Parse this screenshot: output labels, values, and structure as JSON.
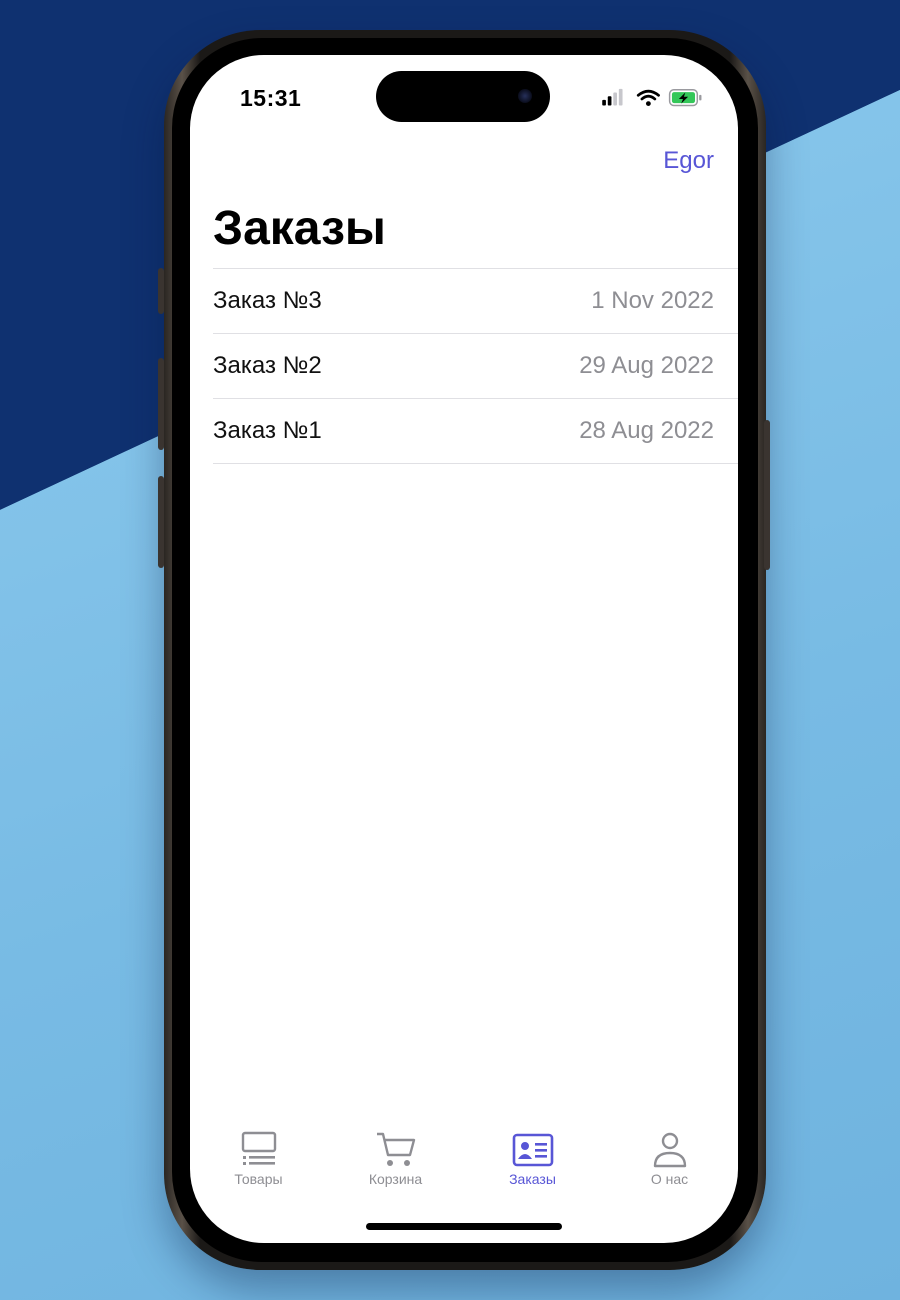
{
  "status_bar": {
    "time": "15:31"
  },
  "nav": {
    "user_button": "Egor"
  },
  "page": {
    "title": "Заказы"
  },
  "orders": [
    {
      "title": "Заказ №3",
      "date": "1 Nov 2022"
    },
    {
      "title": "Заказ №2",
      "date": "29 Aug 2022"
    },
    {
      "title": "Заказ №1",
      "date": "28 Aug 2022"
    }
  ],
  "tabs": [
    {
      "label": "Товары",
      "icon": "products-icon",
      "active": false
    },
    {
      "label": "Корзина",
      "icon": "cart-icon",
      "active": false
    },
    {
      "label": "Заказы",
      "icon": "orders-icon",
      "active": true
    },
    {
      "label": "О нас",
      "icon": "person-icon",
      "active": false
    }
  ],
  "colors": {
    "accent": "#5856d6",
    "secondary_text": "#8e8e93",
    "battery": "#34c759"
  }
}
